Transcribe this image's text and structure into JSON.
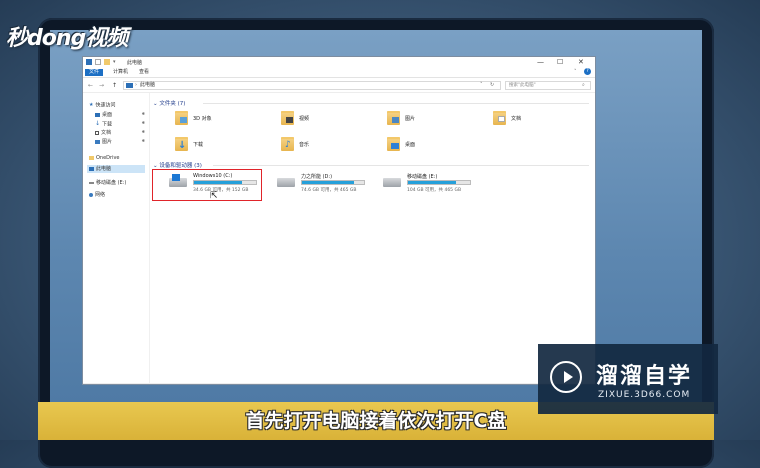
{
  "watermark": {
    "brand": "秒dong视频"
  },
  "window": {
    "title": "此电脑",
    "controls": {
      "minimize": "—",
      "maximize": "☐",
      "close": "✕"
    },
    "ribbon_tabs": [
      {
        "label": "文件",
        "active": true
      },
      {
        "label": "计算机",
        "active": false
      },
      {
        "label": "查看",
        "active": false
      }
    ],
    "help_icon": "?"
  },
  "address_bar": {
    "back": "←",
    "forward": "→",
    "up": "↑",
    "path": "此电脑",
    "separator": "›",
    "search_placeholder": "搜索\"此电脑\""
  },
  "sidebar": {
    "items": [
      {
        "label": "快速访问",
        "icon": "star-icon",
        "pinned": false,
        "selected": false
      },
      {
        "label": "桌面",
        "icon": "desktop-icon",
        "pinned": true,
        "selected": false
      },
      {
        "label": "下载",
        "icon": "download-icon",
        "pinned": true,
        "selected": false
      },
      {
        "label": "文档",
        "icon": "document-icon",
        "pinned": true,
        "selected": false
      },
      {
        "label": "图片",
        "icon": "picture-icon",
        "pinned": true,
        "selected": false
      },
      {
        "label": "OneDrive",
        "icon": "cloud-icon",
        "pinned": false,
        "selected": false
      },
      {
        "label": "此电脑",
        "icon": "computer-icon",
        "pinned": false,
        "selected": true
      },
      {
        "label": "移动磁盘 (E:)",
        "icon": "drive-icon",
        "pinned": false,
        "selected": false
      },
      {
        "label": "网络",
        "icon": "network-icon",
        "pinned": false,
        "selected": false
      }
    ],
    "pin_glyph": "✱"
  },
  "folders_group": {
    "title": "文件夹 (7)",
    "items": [
      {
        "label": "3D 对象",
        "icon": "3d-objects-icon"
      },
      {
        "label": "视频",
        "icon": "video-icon"
      },
      {
        "label": "图片",
        "icon": "picture-icon"
      },
      {
        "label": "文档",
        "icon": "document-icon"
      },
      {
        "label": "下载",
        "icon": "download-icon"
      },
      {
        "label": "音乐",
        "icon": "music-icon"
      },
      {
        "label": "桌面",
        "icon": "desktop-icon"
      }
    ]
  },
  "drives_group": {
    "title": "设备和驱动器 (3)",
    "items": [
      {
        "label": "Windows10 (C:)",
        "info": "34.6 GB 可用，共 152 GB",
        "used_fraction": 0.77,
        "highlighted": true
      },
      {
        "label": "力之所能 (D:)",
        "info": "74.6 GB 可用，共 465 GB",
        "used_fraction": 0.84,
        "highlighted": false
      },
      {
        "label": "移动磁盘 (E:)",
        "info": "104 GB 可用，共 465 GB",
        "used_fraction": 0.78,
        "highlighted": false
      }
    ]
  },
  "caption": {
    "text": "首先打开电脑接着依次打开C盘"
  },
  "logo": {
    "title": "溜溜自学",
    "url": "ZIXUE.3D66.COM"
  },
  "colors": {
    "accent": "#26a0da",
    "ribbon_active": "#1c6fc4",
    "highlight": "#e0242a",
    "caption_bg": "#e3be45"
  }
}
